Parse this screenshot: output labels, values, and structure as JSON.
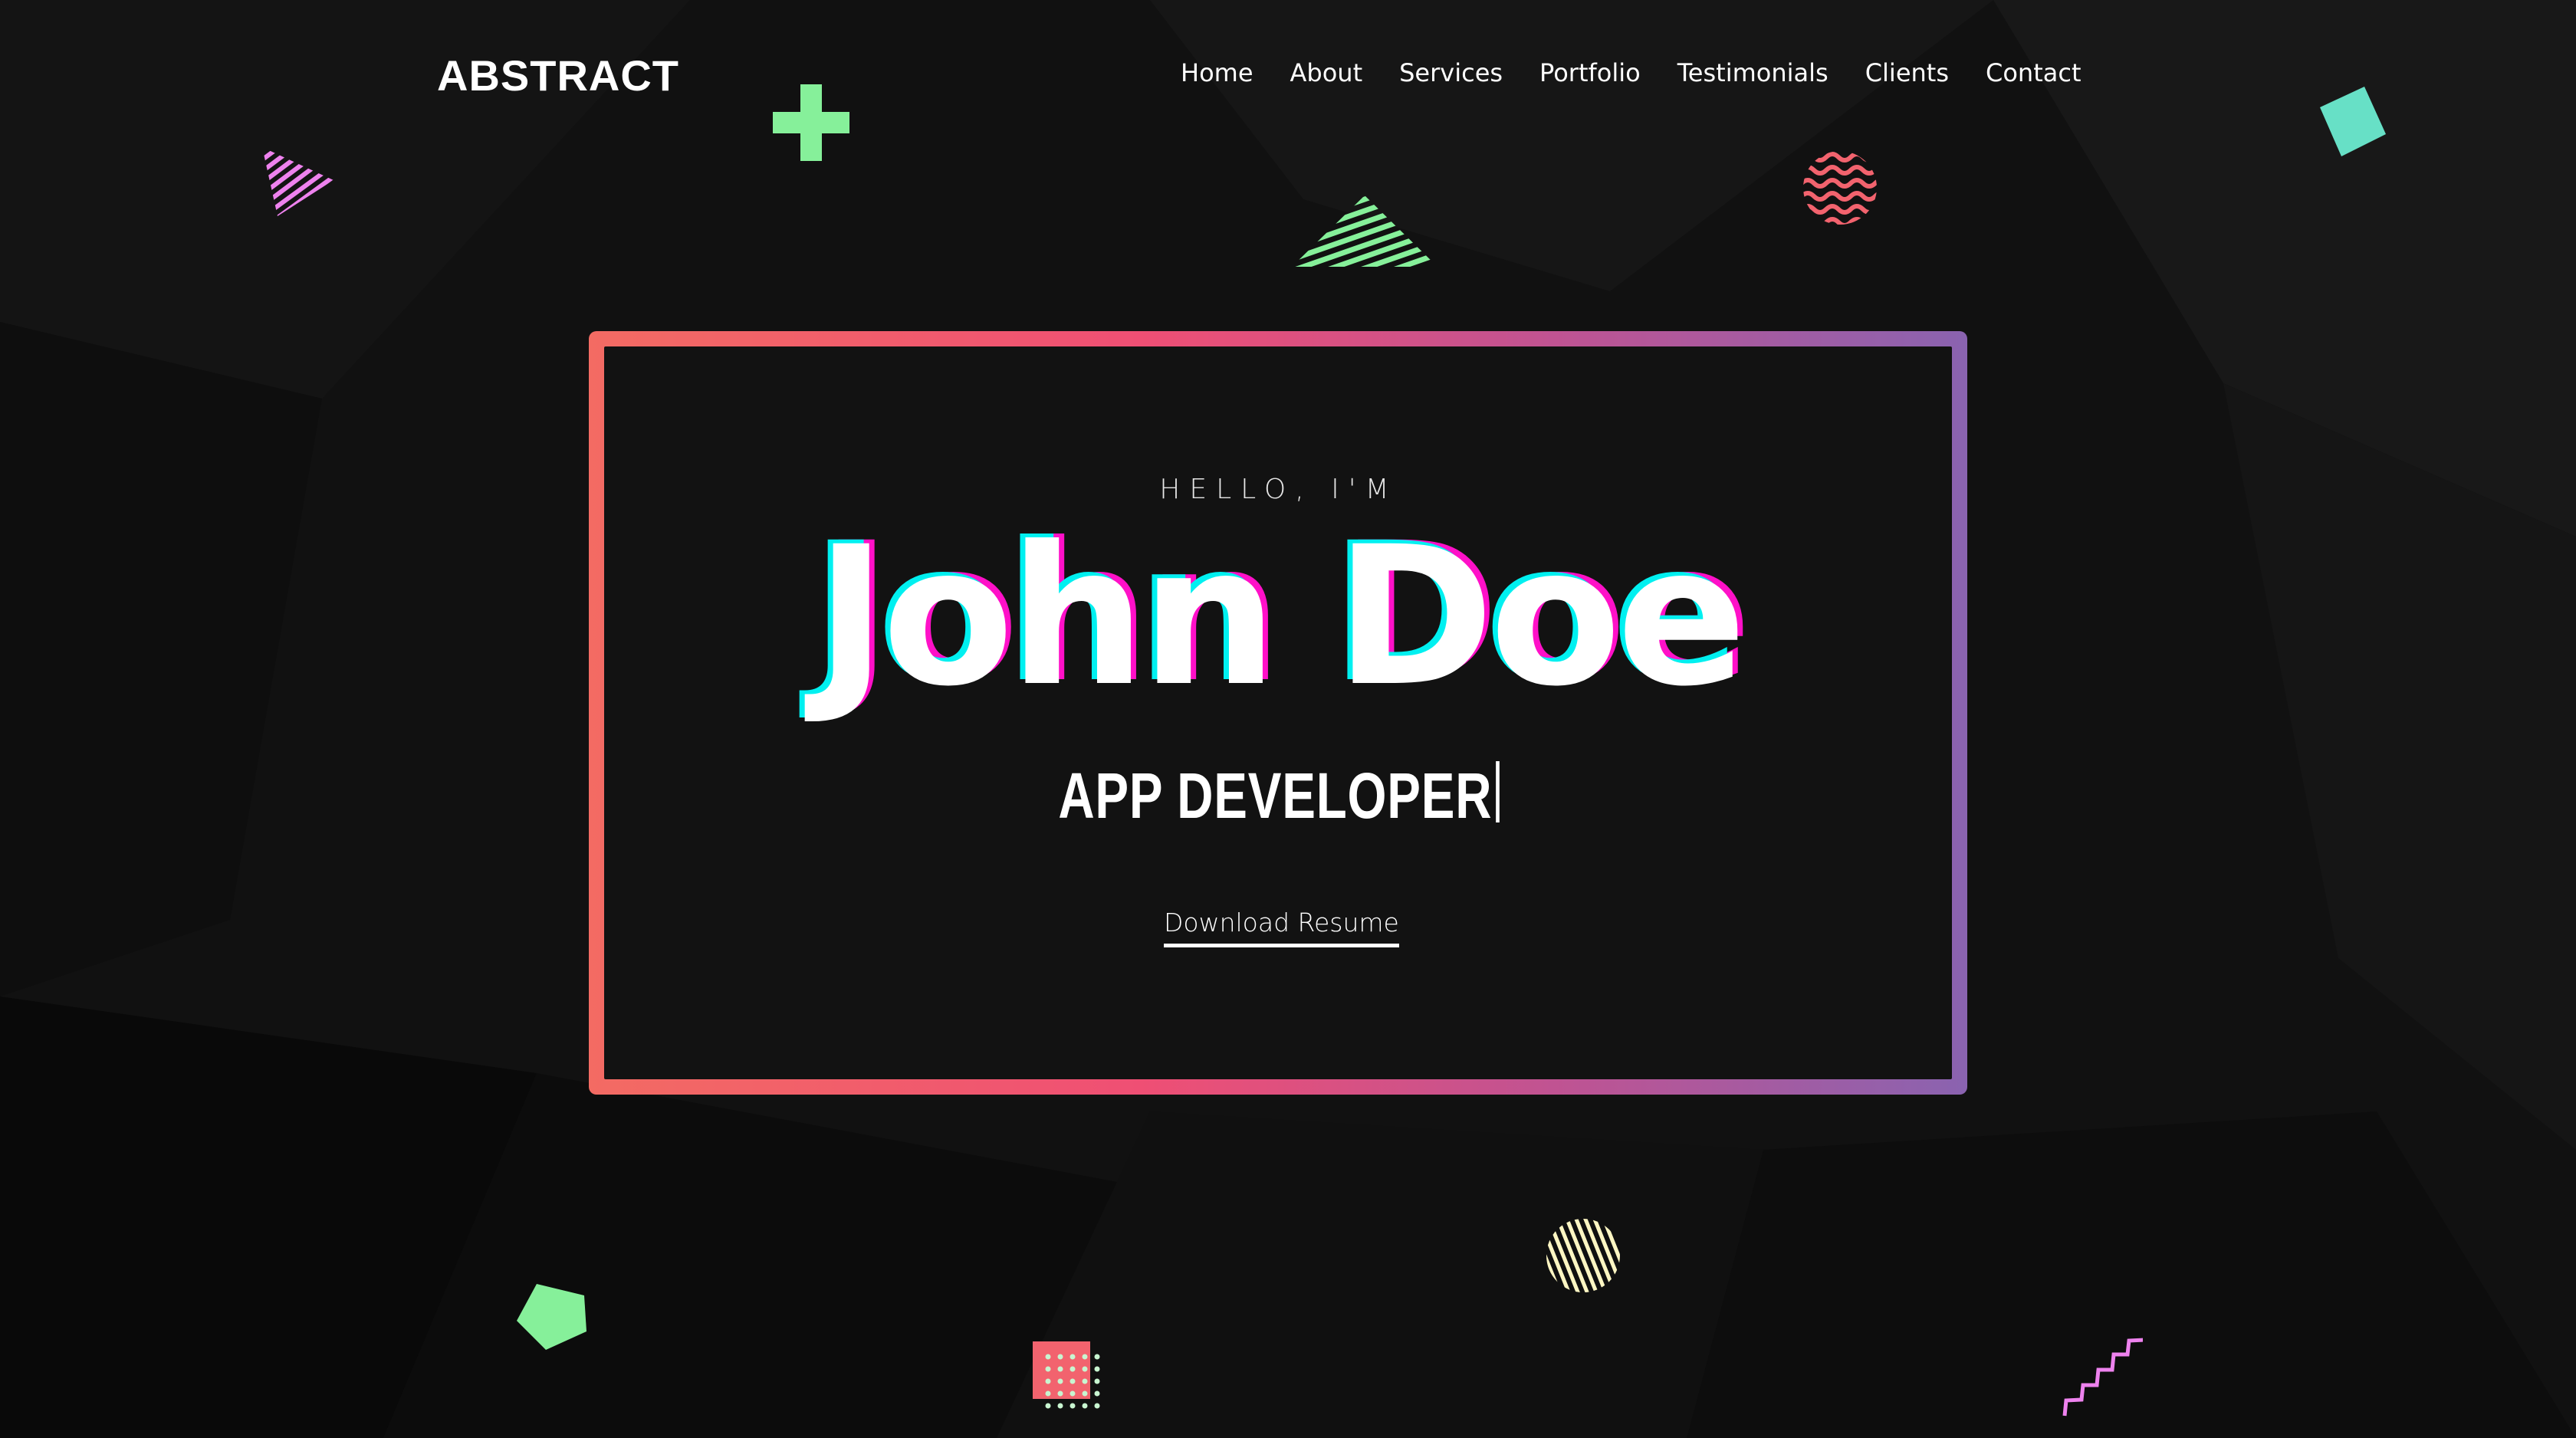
{
  "header": {
    "logo": "ABSTRACT",
    "nav": [
      {
        "label": "Home"
      },
      {
        "label": "About"
      },
      {
        "label": "Services"
      },
      {
        "label": "Portfolio"
      },
      {
        "label": "Testimonials"
      },
      {
        "label": "Clients"
      },
      {
        "label": "Contact"
      }
    ]
  },
  "hero": {
    "greeting": "HELLO, I'M",
    "name": "John Doe",
    "role": "APP DEVELOPER",
    "download_label": "Download Resume"
  },
  "colors": {
    "background": "#111111",
    "frame_gradient": [
      "#f36b63",
      "#ef4f74",
      "#c05392",
      "#8a63b0"
    ],
    "glitch_cyan": "#00f0f0",
    "glitch_magenta": "#ff10c8",
    "green": "#86f09a",
    "pink": "#ee82ee",
    "coral": "#f2636e",
    "teal": "#67e0c6",
    "cream": "#fdf6c3"
  },
  "decorations": [
    {
      "icon": "striped-triangle-icon",
      "color": "pink"
    },
    {
      "icon": "plus-icon",
      "color": "green"
    },
    {
      "icon": "striped-triangle-icon",
      "color": "green"
    },
    {
      "icon": "wavy-circle-icon",
      "color": "coral"
    },
    {
      "icon": "square-icon",
      "color": "teal"
    },
    {
      "icon": "pentagon-icon",
      "color": "green"
    },
    {
      "icon": "dotted-square-icon",
      "color": "coral"
    },
    {
      "icon": "striped-circle-icon",
      "color": "cream"
    },
    {
      "icon": "zigzag-stairs-icon",
      "color": "pink"
    }
  ]
}
